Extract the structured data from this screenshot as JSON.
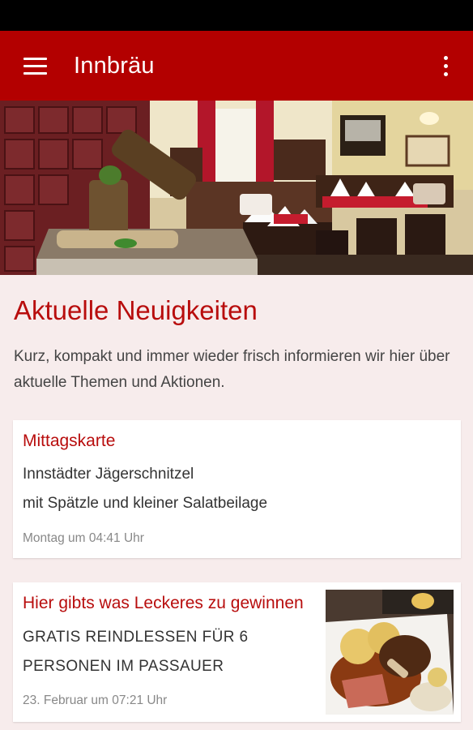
{
  "app_bar": {
    "title": "Innbräu",
    "menu_icon": "hamburger-menu-icon",
    "overflow_icon": "more-vert-icon",
    "color": "#b30000"
  },
  "hero": {
    "image": "restaurant-interior-photo"
  },
  "section": {
    "title": "Aktuelle Neuigkeiten",
    "description": "Kurz, kompakt und immer wieder frisch informieren wir hier über aktuelle Themen und Aktionen."
  },
  "posts": [
    {
      "title": "Mittagskarte",
      "lines": [
        "Innstädter Jägerschnitzel",
        "mit Spätzle und kleiner Salatbeilage"
      ],
      "time": "Montag um 04:41 Uhr"
    },
    {
      "title": "Hier gibts was Leckeres zu gewinnen",
      "lines": [
        "GRATIS REINDLESSEN FÜR 6",
        "PERSONEN IM PASSAUER"
      ],
      "time": "23. Februar um 07:21 Uhr",
      "thumbnail": "roast-pork-dish-photo"
    }
  ],
  "colors": {
    "accent": "#b80d0d",
    "background": "#f7ecec"
  }
}
